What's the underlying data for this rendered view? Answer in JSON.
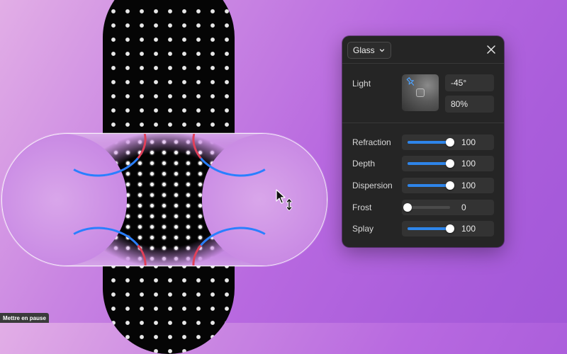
{
  "panel": {
    "title": "Glass",
    "icons": {
      "dropdown": "chevron-down-icon",
      "close": "close-icon",
      "light_pin": "pin-icon"
    },
    "light": {
      "label": "Light",
      "angle": "-45°",
      "intensity": "80%"
    },
    "sliders": [
      {
        "label": "Refraction",
        "value": "100",
        "level": 1.0
      },
      {
        "label": "Depth",
        "value": "100",
        "level": 1.0
      },
      {
        "label": "Dispersion",
        "value": "100",
        "level": 1.0
      },
      {
        "label": "Frost",
        "value": "0",
        "level": 0.0
      },
      {
        "label": "Splay",
        "value": "100",
        "level": 1.0
      }
    ],
    "accent_color": "#2e85ea"
  },
  "video": {
    "pause_label": "Mettre en pause"
  },
  "canvas": {
    "background_colors": [
      "#e2aee6",
      "#a257d8"
    ],
    "pattern_color": "#050505",
    "dot_color": "#e8e8e8"
  }
}
